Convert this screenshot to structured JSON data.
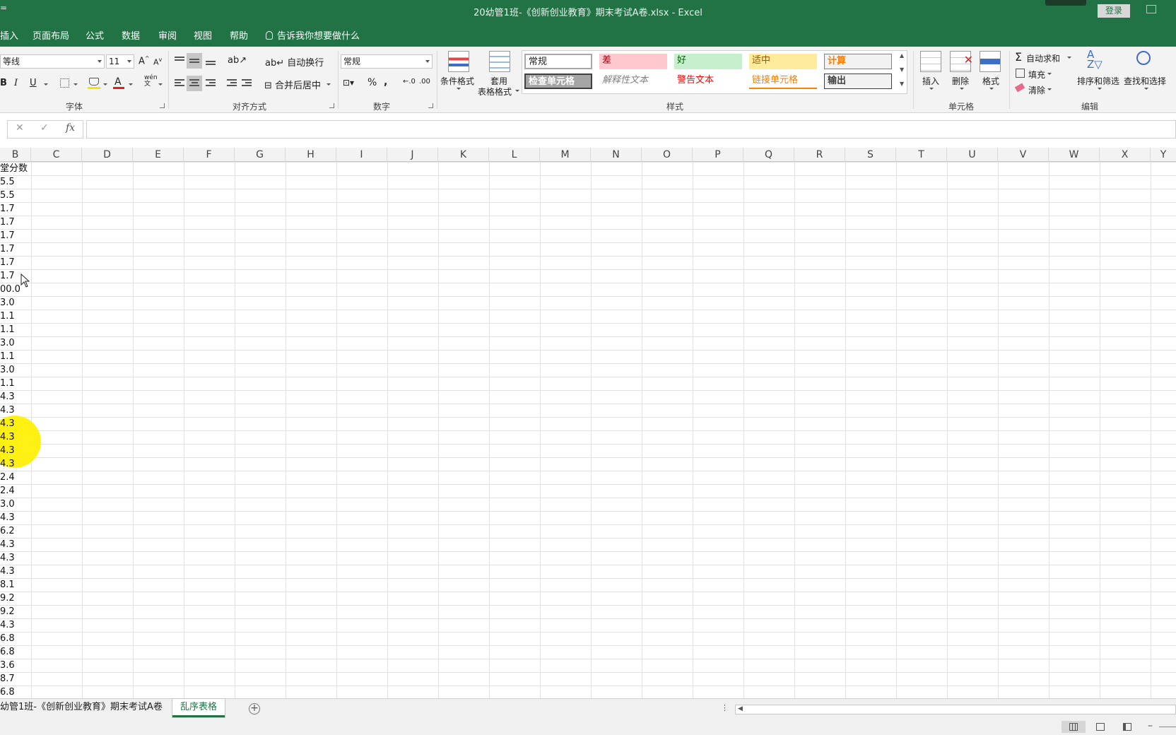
{
  "window": {
    "title": "20幼管1班-《创新创业教育》期末考试A卷.xlsx  -  Excel",
    "login": "登录",
    "corner": "="
  },
  "menu": {
    "items": [
      "插入",
      "页面布局",
      "公式",
      "数据",
      "审阅",
      "视图",
      "帮助"
    ],
    "tell": "告诉我你想要做什么"
  },
  "ribbon": {
    "font": {
      "name": "等线",
      "size": "11",
      "label": "字体"
    },
    "align": {
      "wrap": "自动换行",
      "merge": "合并后居中",
      "label": "对齐方式"
    },
    "number": {
      "format": "常规",
      "label": "数字"
    },
    "styles": {
      "cond": "条件格式",
      "table1": "套用",
      "table2": "表格格式",
      "label": "样式",
      "boxes": [
        "常规",
        "差",
        "好",
        "适中",
        "计算",
        "检查单元格",
        "解释性文本",
        "警告文本",
        "链接单元格",
        "输出"
      ]
    },
    "cells": {
      "insert": "插入",
      "delete": "删除",
      "format": "格式",
      "label": "单元格"
    },
    "edit": {
      "autosum": "自动求和",
      "fill": "填充",
      "clear": "清除",
      "sort": "排序和筛选",
      "find": "查找和选择",
      "label": "编辑"
    }
  },
  "formula": {
    "cancel": "✕",
    "confirm": "✓",
    "fx": "fx"
  },
  "grid": {
    "columns": [
      "B",
      "C",
      "D",
      "E",
      "F",
      "G",
      "H",
      "I",
      "J",
      "K",
      "L",
      "M",
      "N",
      "O",
      "P",
      "Q",
      "R",
      "S",
      "T",
      "U",
      "V",
      "W",
      "X",
      "Y"
    ],
    "values": [
      "堂分数",
      "5.5",
      "5.5",
      "1.7",
      "1.7",
      "1.7",
      "1.7",
      "1.7",
      "1.7",
      "00.0",
      "3.0",
      "1.1",
      "1.1",
      "3.0",
      "1.1",
      "3.0",
      "1.1",
      "4.3",
      "4.3",
      "4.3",
      "4.3",
      "4.3",
      "4.3",
      "2.4",
      "2.4",
      "3.0",
      "4.3",
      "6.2",
      "4.3",
      "4.3",
      "4.3",
      "8.1",
      "9.2",
      "9.2",
      "4.3",
      "6.8",
      "6.8",
      "3.6",
      "8.7",
      "6.8"
    ]
  },
  "sheets": {
    "tabs": [
      "幼管1班-《创新创业教育》期末考试A卷",
      "乱序表格"
    ],
    "add": "+"
  },
  "status": {
    "zoom_minus": "–"
  }
}
